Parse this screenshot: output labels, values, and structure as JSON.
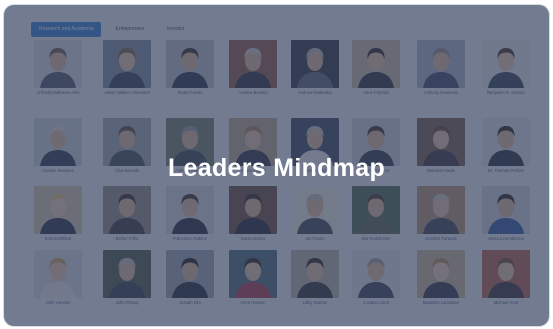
{
  "tabs": [
    {
      "label": "Research and Academia",
      "active": true
    },
    {
      "label": "Entrepreneur",
      "active": false
    },
    {
      "label": "Investor",
      "active": false
    }
  ],
  "overlay_title": "Leaders Mindmap",
  "people": [
    {
      "name": "Arhnold Matthews Arini",
      "bg": "#cfd6de",
      "shirt": "#4a5566",
      "skin": "#d8b49a",
      "hair": "#6b5a4a"
    },
    {
      "name": "Alison Walmer Simmons",
      "bg": "#7d8a9a",
      "shirt": "#2f3c52",
      "skin": "#e2c0a6",
      "hair": "#7a5b3e"
    },
    {
      "name": "Stuart Fowler",
      "bg": "#b7bcc3",
      "shirt": "#25304a",
      "skin": "#d9b497",
      "hair": "#3a2c22"
    },
    {
      "name": "Andrew Boulton",
      "bg": "#8f5a4a",
      "shirt": "#2a2f3c",
      "skin": "#dcb79d",
      "hair": "#c9c9c9"
    },
    {
      "name": "Andrew Hattersley",
      "bg": "#2e3340",
      "shirt": "#59647a",
      "skin": "#d8b49a",
      "hair": "#b7b7b7"
    },
    {
      "name": "Anne Pirpruth",
      "bg": "#c4b6a3",
      "shirt": "#2b2f38",
      "skin": "#e0bca0",
      "hair": "#2c241f"
    },
    {
      "name": "Anthony Heasman",
      "bg": "#a7b4c3",
      "shirt": "#3b4a63",
      "skin": "#dcb79d",
      "hair": "#8a8a8a"
    },
    {
      "name": "Benjamin O. Grosso",
      "bg": "#dfe3e8",
      "shirt": "#334057",
      "skin": "#e4c2a8",
      "hair": "#4a3628"
    },
    {
      "name": "Charles Swanton",
      "bg": "#c8d0da",
      "shirt": "#2a3550",
      "skin": "#dcb79d",
      "hair": "#d7d7d7"
    },
    {
      "name": "Clive Bounds",
      "bg": "#9fa7b1",
      "shirt": "#454c57",
      "skin": "#d8b49a",
      "hair": "#5b4a3b"
    },
    {
      "name": "Anthony Mayers",
      "bg": "#6e7c6a",
      "shirt": "#39414e",
      "skin": "#d9b497",
      "hair": "#9a9a9a"
    },
    {
      "name": "Gillian Mayes",
      "bg": "#b7a58c",
      "shirt": "#2c3445",
      "skin": "#e2c0a6",
      "hair": "#a47c52"
    },
    {
      "name": "Daniel Kidd",
      "bg": "#3a475c",
      "shirt": "#e6e8ec",
      "skin": "#dcb79d",
      "hair": "#c1c1c1"
    },
    {
      "name": "Ben O'Connor",
      "bg": "#c9ced6",
      "shirt": "#2d3748",
      "skin": "#d8b49a",
      "hair": "#3b2f27"
    },
    {
      "name": "Deborah Hattie",
      "bg": "#7a5b4e",
      "shirt": "#3a3440",
      "skin": "#e2c0a6",
      "hair": "#6b3f2a"
    },
    {
      "name": "Dr. Thomas Perkins",
      "bg": "#d8dde4",
      "shirt": "#252d3d",
      "skin": "#dcb79d",
      "hair": "#2a221d"
    },
    {
      "name": "Emma Whited",
      "bg": "#d3c3aa",
      "shirt": "#283149",
      "skin": "#ecccb2",
      "hair": "#e0c27a"
    },
    {
      "name": "Esther Pirfie",
      "bg": "#8e8a80",
      "shirt": "#3b3a3f",
      "skin": "#d8b49a",
      "hair": "#3a2a22"
    },
    {
      "name": "Francesco Rubino",
      "bg": "#ced3da",
      "shirt": "#202838",
      "skin": "#dcb79d",
      "hair": "#3b2f27"
    },
    {
      "name": "Gaolo Gonzo",
      "bg": "#6a4a3c",
      "shirt": "#1f2533",
      "skin": "#d8b49a",
      "hair": "#2e2520"
    },
    {
      "name": "Ian Frame",
      "bg": "#e8e6e0",
      "shirt": "#3c4454",
      "skin": "#dcb79d",
      "hair": "#b9b9b9"
    },
    {
      "name": "Ilva Rodchenko",
      "bg": "#4f6b55",
      "shirt": "#5a6150",
      "skin": "#d9b497",
      "hair": "#4a3a2c"
    },
    {
      "name": "Jennifer Fenwick",
      "bg": "#b28f74",
      "shirt": "#3a4352",
      "skin": "#e2c0a6",
      "hair": "#c9c3b8"
    },
    {
      "name": "Jessica Hendricson",
      "bg": "#c9d0d8",
      "shirt": "#2c5aa0",
      "skin": "#d8b49a",
      "hair": "#2a211c"
    },
    {
      "name": "John Hendrie",
      "bg": "#cfd5dc",
      "shirt": "#e3e5e9",
      "skin": "#e4c2a8",
      "hair": "#c8a468"
    },
    {
      "name": "John Pickup",
      "bg": "#4e5a4a",
      "shirt": "#343c48",
      "skin": "#dcb79d",
      "hair": "#bdbdbd"
    },
    {
      "name": "Joseph Kim",
      "bg": "#9aa5b2",
      "shirt": "#1f2736",
      "skin": "#d9b497",
      "hair": "#1e1a18"
    },
    {
      "name": "Anne Hanson",
      "bg": "#4b6a7c",
      "shirt": "#a8394a",
      "skin": "#e2c0a6",
      "hair": "#2a211c"
    },
    {
      "name": "Libby Warner",
      "bg": "#b6b0a8",
      "shirt": "#2c2f36",
      "skin": "#e0bca0",
      "hair": "#2b211c"
    },
    {
      "name": "Luciano Conti",
      "bg": "#d9dee4",
      "shirt": "#3a4456",
      "skin": "#dcb79d",
      "hair": "#9e9e9e"
    },
    {
      "name": "Madeline Lancaster",
      "bg": "#c6b295",
      "shirt": "#2f3748",
      "skin": "#ecccb2",
      "hair": "#b48a5a"
    },
    {
      "name": "Michael Hunt",
      "bg": "#b35e4a",
      "shirt": "#3a2f3c",
      "skin": "#e2c0a6",
      "hair": "#6a4a32"
    }
  ]
}
